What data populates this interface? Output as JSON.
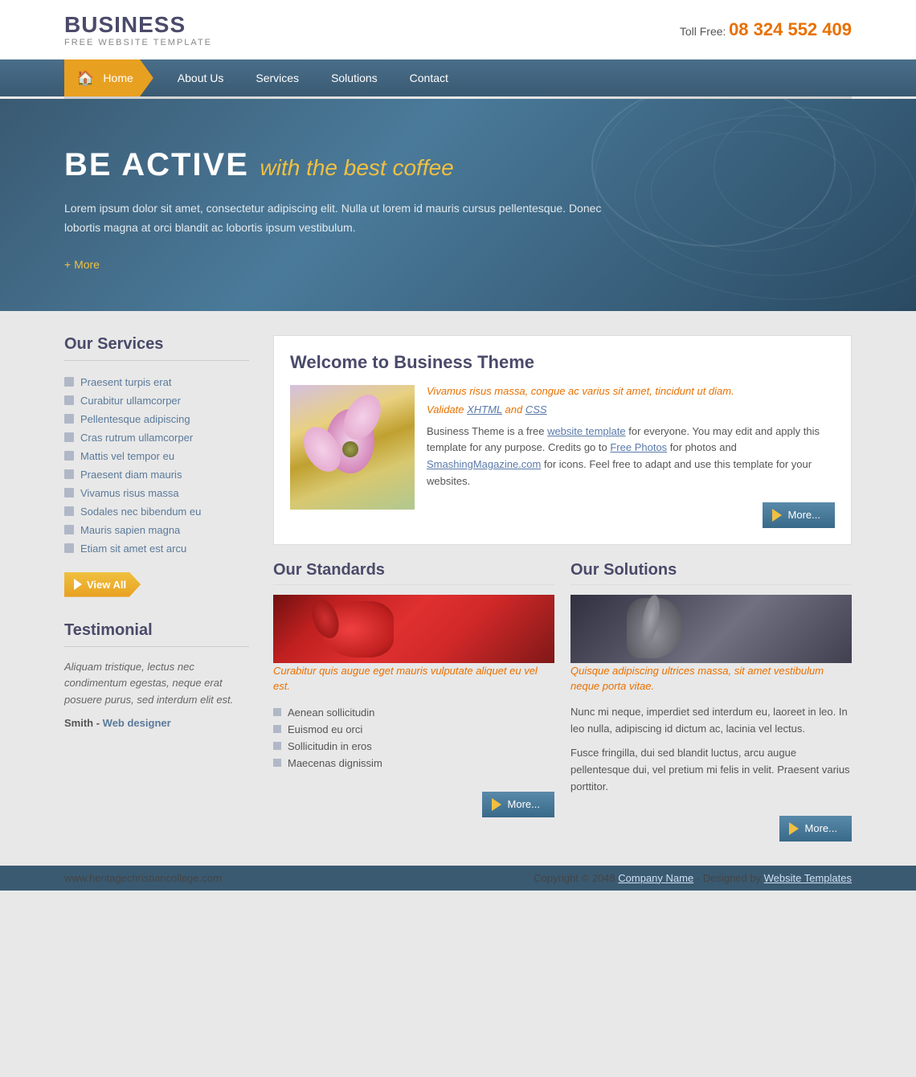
{
  "header": {
    "logo_title": "BUSINESS",
    "logo_subtitle": "FREE WEBSITE TEMPLATE",
    "phone_label": "Toll Free:",
    "phone_number": "08 324 552 409"
  },
  "nav": {
    "home": "Home",
    "about": "About Us",
    "services": "Services",
    "solutions": "Solutions",
    "contact": "Contact"
  },
  "hero": {
    "title": "BE ACTIVE",
    "subtitle": "with the best coffee",
    "description": "Lorem ipsum dolor sit amet, consectetur adipiscing elit. Nulla ut lorem id mauris cursus pellentesque. Donec lobortis magna at orci blandit ac lobortis ipsum vestibulum.",
    "more_label": "+ More"
  },
  "sidebar": {
    "services_title": "Our Services",
    "services_items": [
      "Praesent turpis erat",
      "Curabitur ullamcorper",
      "Pellentesque adipiscing",
      "Cras rutrum ullamcorper",
      "Mattis vel tempor eu",
      "Praesent diam mauris",
      "Vivamus risus massa",
      "Sodales nec bibendum eu",
      "Mauris sapien magna",
      "Etiam sit amet est arcu"
    ],
    "view_all_label": "View All",
    "testimonial_title": "Testimonial",
    "testimonial_text": "Aliquam tristique, lectus nec condimentum egestas, neque erat posuere purus, sed interdum elit est.",
    "testimonial_author": "Smith - ",
    "testimonial_author_link": "Web designer"
  },
  "welcome": {
    "title": "Welcome to Business Theme",
    "italic1": "Vivamus risus massa, congue ac varius sit amet, tincidunt ut diam.",
    "validate_text": "Validate ",
    "validate_xhtml": "XHTML",
    "validate_and": " and ",
    "validate_css": "CSS",
    "body_text": "Business Theme is a free website template for everyone. You may edit and apply this template for any purpose. Credits go to Free Photos for photos and SmashingMagazine.com for icons. Feel free to adapt and use this template for your websites.",
    "more_label": "More..."
  },
  "standards": {
    "title": "Our Standards",
    "italic": "Curabitur quis augue eget mauris vulputate aliquet eu vel est.",
    "items": [
      "Aenean sollicitudin",
      "Euismod eu orci",
      "Sollicitudin in eros",
      "Maecenas dignissim"
    ],
    "more_label": "More..."
  },
  "solutions": {
    "title": "Our Solutions",
    "italic": "Quisque adipiscing ultrices massa, sit amet vestibulum neque porta vitae.",
    "body1": "Nunc mi neque, imperdiet sed interdum eu, laoreet in leo. In leo nulla, adipiscing id dictum ac, lacinia vel lectus.",
    "body2": "Fusce fringilla, dui sed blandit luctus, arcu augue pellentesque dui, vel pretium mi felis in velit. Praesent varius porttitor.",
    "more_label": "More..."
  },
  "footer": {
    "site_url": "www.heritagechristiancollege.com",
    "copyright": "Copyright © 2048 ",
    "company_link": "Company Name",
    "designed_by": " - Designed by ",
    "templates_link": "Website Templates"
  }
}
